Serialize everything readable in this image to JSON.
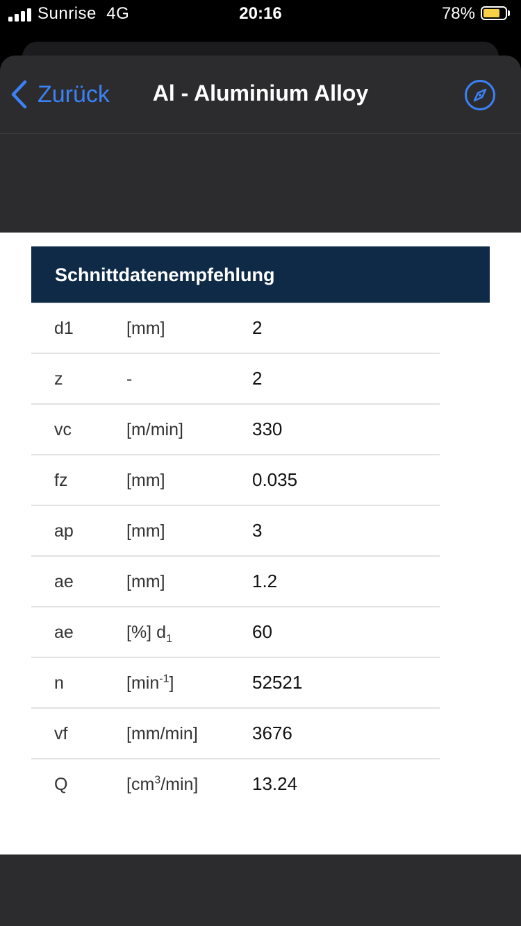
{
  "status_bar": {
    "carrier": "Sunrise",
    "network": "4G",
    "time": "20:16",
    "battery_percent": "78%",
    "battery_level": 0.78,
    "battery_color": "#f7d046"
  },
  "nav": {
    "back_label": "Zurück",
    "title": "Al - Aluminium Alloy",
    "accent_color": "#3b82f6",
    "back_icon": "chevron-left-icon",
    "right_icon": "compass-icon"
  },
  "table": {
    "header": "Schnittdatenempfehlung",
    "header_color": "#0e2a47",
    "rows": [
      {
        "param": "d1",
        "unit": "[mm]",
        "value": "2"
      },
      {
        "param": "z",
        "unit": "-",
        "value": "2"
      },
      {
        "param": "vc",
        "unit": "[m/min]",
        "value": "330"
      },
      {
        "param": "fz",
        "unit": "[mm]",
        "value": "0.035"
      },
      {
        "param": "ap",
        "unit": "[mm]",
        "value": "3"
      },
      {
        "param": "ae",
        "unit": "[mm]",
        "value": "1.2"
      },
      {
        "param": "ae",
        "unit_main": "[%] d",
        "unit_sub": "1",
        "value": "60"
      },
      {
        "param": "n",
        "unit_pre": "[min",
        "unit_sup": "-1",
        "unit_post": "]",
        "value": "52521"
      },
      {
        "param": "vf",
        "unit": "[mm/min]",
        "value": "3676"
      },
      {
        "param": "Q",
        "unit_pre": "[cm",
        "unit_sup": "3",
        "unit_post": "/min]",
        "value": "13.24"
      }
    ]
  }
}
